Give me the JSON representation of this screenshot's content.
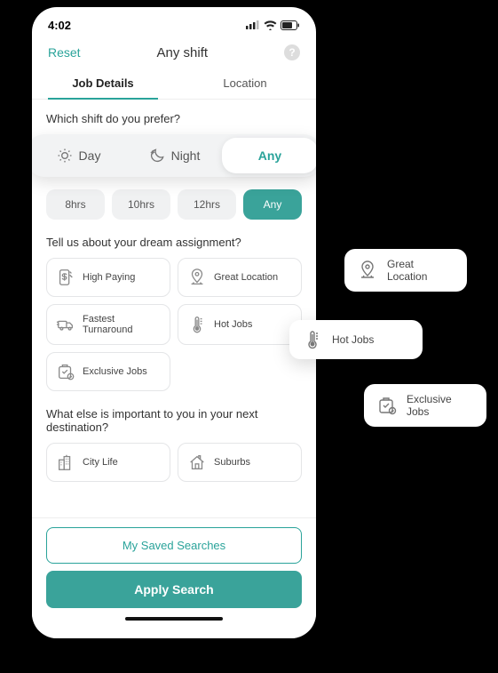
{
  "statusbar": {
    "time": "4:02"
  },
  "nav": {
    "reset": "Reset",
    "title": "Any shift"
  },
  "tabs": {
    "details": "Job Details",
    "location": "Location"
  },
  "questions": {
    "shift": "Which shift do you prefer?",
    "dream": "Tell us about your dream assignment?",
    "dest": "What else is important to you in your next destination?"
  },
  "shifts": {
    "day": "Day",
    "night": "Night",
    "any": "Any"
  },
  "hours": [
    "8hrs",
    "10hrs",
    "12hrs",
    "Any"
  ],
  "dreams": {
    "high_paying": "High Paying",
    "great_location": "Great Location",
    "fastest_turnaround": "Fastest Turnaround",
    "hot_jobs": "Hot Jobs",
    "exclusive_jobs": "Exclusive Jobs"
  },
  "dest": {
    "city_life": "City Life",
    "suburbs": "Suburbs"
  },
  "buttons": {
    "saved": "My Saved Searches",
    "apply": "Apply Search"
  },
  "floating": {
    "great_location": "Great Location",
    "hot_jobs": "Hot Jobs",
    "exclusive_jobs": "Exclusive Jobs"
  }
}
